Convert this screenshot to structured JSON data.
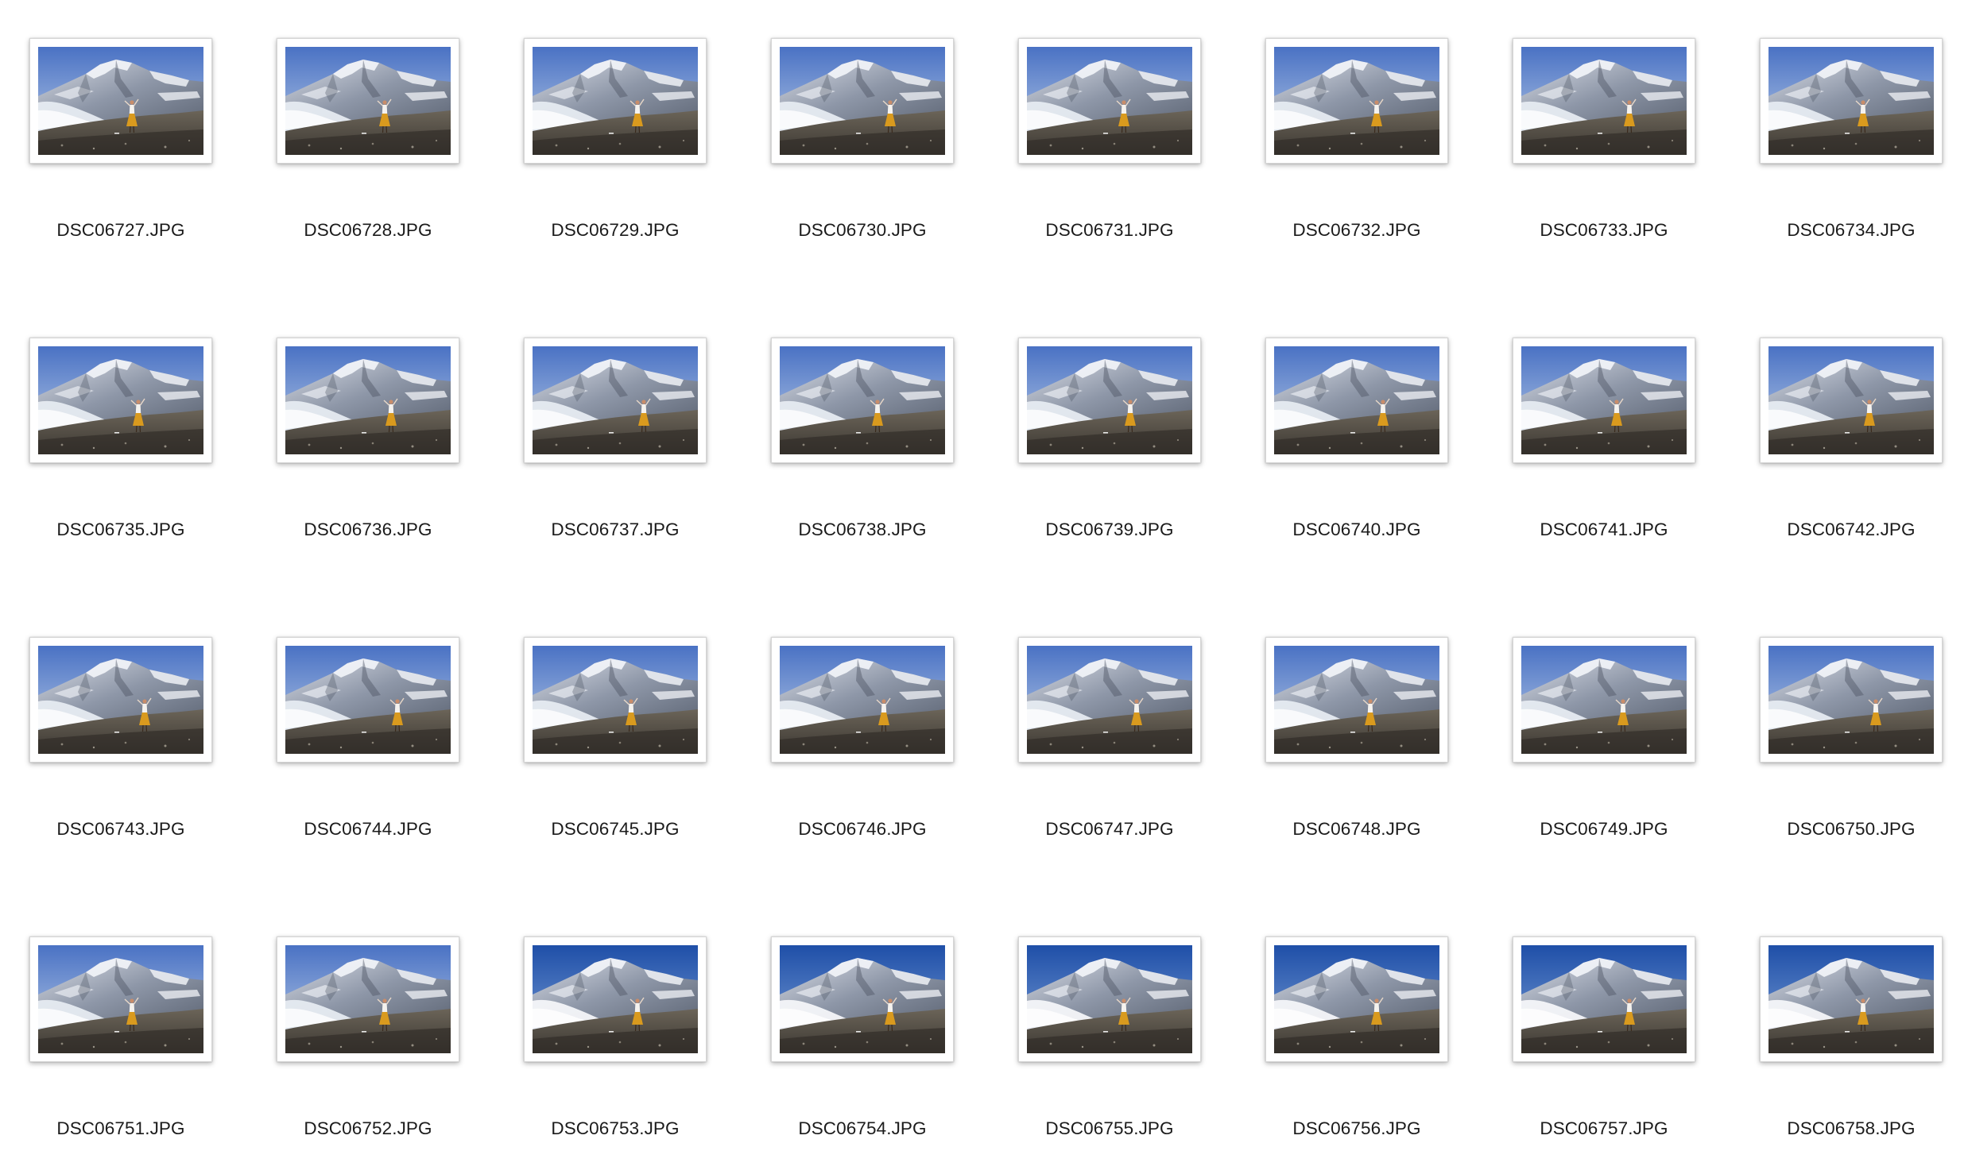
{
  "window": {
    "view": "icon-grid"
  },
  "colors": {
    "label_text": "#1b1b1b",
    "frame_border": "#d6d6d6",
    "background": "#ffffff"
  },
  "icon_names": {
    "thumbnail": "photo-thumbnail-icon"
  },
  "files": [
    {
      "name": "DSC06727.JPG"
    },
    {
      "name": "DSC06728.JPG"
    },
    {
      "name": "DSC06729.JPG"
    },
    {
      "name": "DSC06730.JPG"
    },
    {
      "name": "DSC06731.JPG"
    },
    {
      "name": "DSC06732.JPG"
    },
    {
      "name": "DSC06733.JPG"
    },
    {
      "name": "DSC06734.JPG"
    },
    {
      "name": "DSC06735.JPG"
    },
    {
      "name": "DSC06736.JPG"
    },
    {
      "name": "DSC06737.JPG"
    },
    {
      "name": "DSC06738.JPG"
    },
    {
      "name": "DSC06739.JPG"
    },
    {
      "name": "DSC06740.JPG"
    },
    {
      "name": "DSC06741.JPG"
    },
    {
      "name": "DSC06742.JPG"
    },
    {
      "name": "DSC06743.JPG"
    },
    {
      "name": "DSC06744.JPG"
    },
    {
      "name": "DSC06745.JPG"
    },
    {
      "name": "DSC06746.JPG"
    },
    {
      "name": "DSC06747.JPG"
    },
    {
      "name": "DSC06748.JPG"
    },
    {
      "name": "DSC06749.JPG"
    },
    {
      "name": "DSC06750.JPG"
    },
    {
      "name": "DSC06751.JPG"
    },
    {
      "name": "DSC06752.JPG"
    },
    {
      "name": "DSC06753.JPG"
    },
    {
      "name": "DSC06754.JPG"
    },
    {
      "name": "DSC06755.JPG"
    },
    {
      "name": "DSC06756.JPG"
    },
    {
      "name": "DSC06757.JPG"
    },
    {
      "name": "DSC06758.JPG"
    }
  ]
}
